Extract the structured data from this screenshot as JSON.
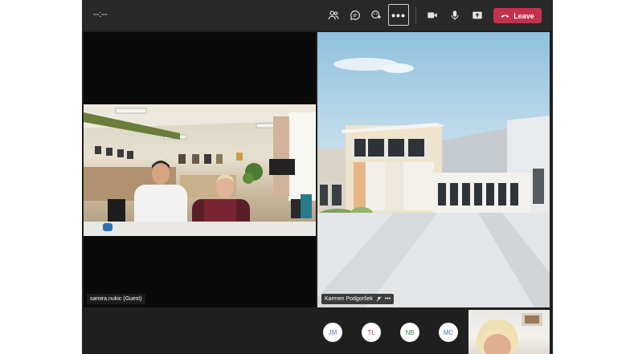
{
  "toolbar": {
    "timer": "--:--",
    "icons": [
      "participants-icon",
      "chat-icon",
      "reactions-icon",
      "more-icon",
      "camera-icon",
      "mic-icon",
      "share-icon",
      "phone-icon"
    ],
    "more_label": "•••",
    "leave_label": "Leave",
    "leave_color": "#c4314b"
  },
  "tiles": [
    {
      "name": "samira.nukic (Guest)"
    },
    {
      "name": "Karmen Podgoršek",
      "menu": "•••"
    }
  ],
  "participants": [
    {
      "initials": "JM",
      "color": "#5b6fbf"
    },
    {
      "initials": "TL",
      "color": "#c4314b"
    },
    {
      "initials": "NB",
      "color": "#2e8b57"
    },
    {
      "initials": "MC",
      "color": "#3a7bbf"
    }
  ]
}
